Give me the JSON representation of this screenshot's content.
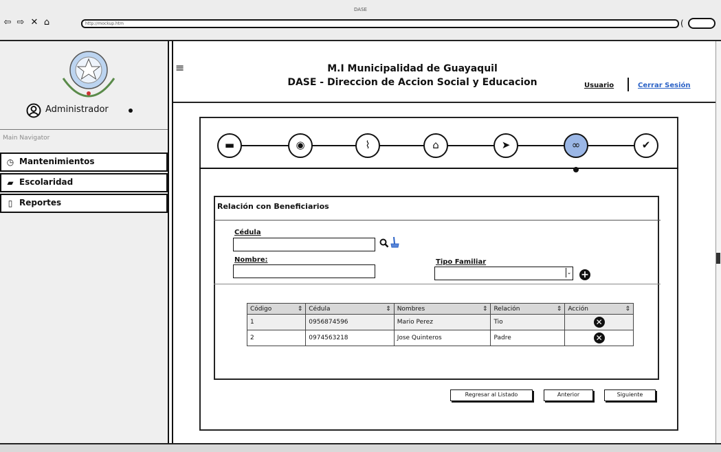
{
  "window": {
    "title": "DASE",
    "url": "http://mockup.htm"
  },
  "header": {
    "line1": "M.I Municipalidad de Guayaquil",
    "line2": "DASE - Direccion de Accion Social y Educacion",
    "user_link": "Usuario",
    "separator": "|",
    "logout_link": "Cerrar Sesión"
  },
  "sidebar": {
    "user_label": "Administrador",
    "nav_caption": "Main Navigator",
    "items": [
      {
        "label": "Mantenimientos",
        "icon": "clock-icon"
      },
      {
        "label": "Escolaridad",
        "icon": "book-icon"
      },
      {
        "label": "Reportes",
        "icon": "document-icon"
      }
    ]
  },
  "wizard": {
    "steps": [
      {
        "icon": "folder-icon",
        "glyph": "▬"
      },
      {
        "icon": "globe-icon",
        "glyph": "◉"
      },
      {
        "icon": "paperclip-icon",
        "glyph": "⌇"
      },
      {
        "icon": "home-icon",
        "glyph": "⌂"
      },
      {
        "icon": "send-icon",
        "glyph": "➤"
      },
      {
        "icon": "link-icon",
        "glyph": "∞",
        "active": true
      },
      {
        "icon": "check-icon",
        "glyph": "✔"
      }
    ]
  },
  "form": {
    "section_title": "Relación con Beneficiarios",
    "cedula_label": "Cédula",
    "cedula_value": "",
    "nombre_label": "Nombre:",
    "nombre_value": "",
    "tipo_label": "Tipo Familiar",
    "tipo_value": ""
  },
  "table": {
    "columns": [
      "Código",
      "Cédula",
      "Nombres",
      "Relación",
      "Acción"
    ],
    "rows": [
      {
        "codigo": "1",
        "cedula": "0956874596",
        "nombres": "Mario Perez",
        "relacion": "Tio"
      },
      {
        "codigo": "2",
        "cedula": "0974563218",
        "nombres": "Jose Quinteros",
        "relacion": "Padre"
      }
    ]
  },
  "buttons": {
    "back": "Regresar al Listado",
    "prev": "Anterior",
    "next": "Siguiente"
  },
  "colors": {
    "active_step": "#9bb7e6"
  }
}
